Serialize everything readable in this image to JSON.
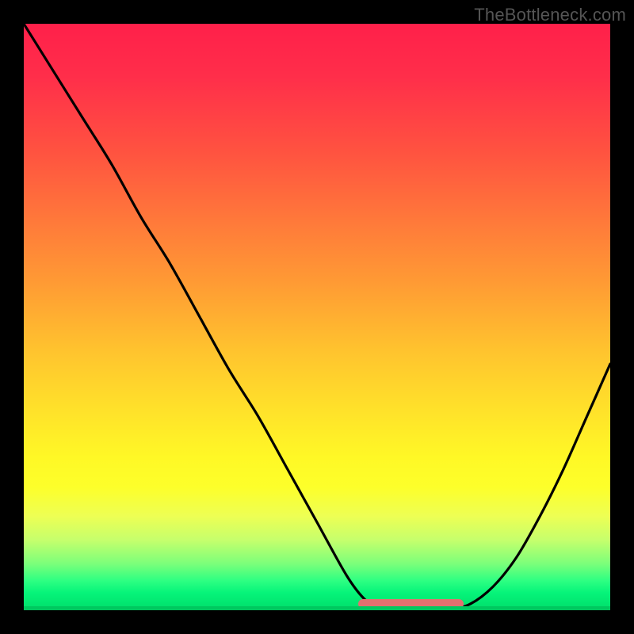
{
  "watermark": "TheBottleneck.com",
  "chart_data": {
    "type": "line",
    "title": "",
    "xlabel": "",
    "ylabel": "",
    "xlim": [
      0,
      1
    ],
    "ylim": [
      0,
      1
    ],
    "x": [
      0.0,
      0.05,
      0.1,
      0.15,
      0.2,
      0.25,
      0.3,
      0.35,
      0.4,
      0.45,
      0.5,
      0.55,
      0.58,
      0.6,
      0.64,
      0.68,
      0.72,
      0.76,
      0.8,
      0.84,
      0.88,
      0.92,
      0.96,
      1.0
    ],
    "values": [
      1.0,
      0.92,
      0.84,
      0.76,
      0.67,
      0.59,
      0.5,
      0.41,
      0.33,
      0.24,
      0.15,
      0.06,
      0.02,
      0.01,
      0.0,
      0.0,
      0.0,
      0.01,
      0.04,
      0.09,
      0.16,
      0.24,
      0.33,
      0.42
    ],
    "gradient_stops": [
      {
        "pos": 0.0,
        "color": "#ff204a"
      },
      {
        "pos": 0.5,
        "color": "#ffc530"
      },
      {
        "pos": 0.8,
        "color": "#fdff2a"
      },
      {
        "pos": 1.0,
        "color": "#00de6a"
      }
    ],
    "bottom_highlight": {
      "x0": 0.57,
      "x1": 0.75,
      "color": "#e27070"
    }
  },
  "colors": {
    "frame_bg": "#000000",
    "curve": "#000000",
    "highlight": "#e27070"
  }
}
